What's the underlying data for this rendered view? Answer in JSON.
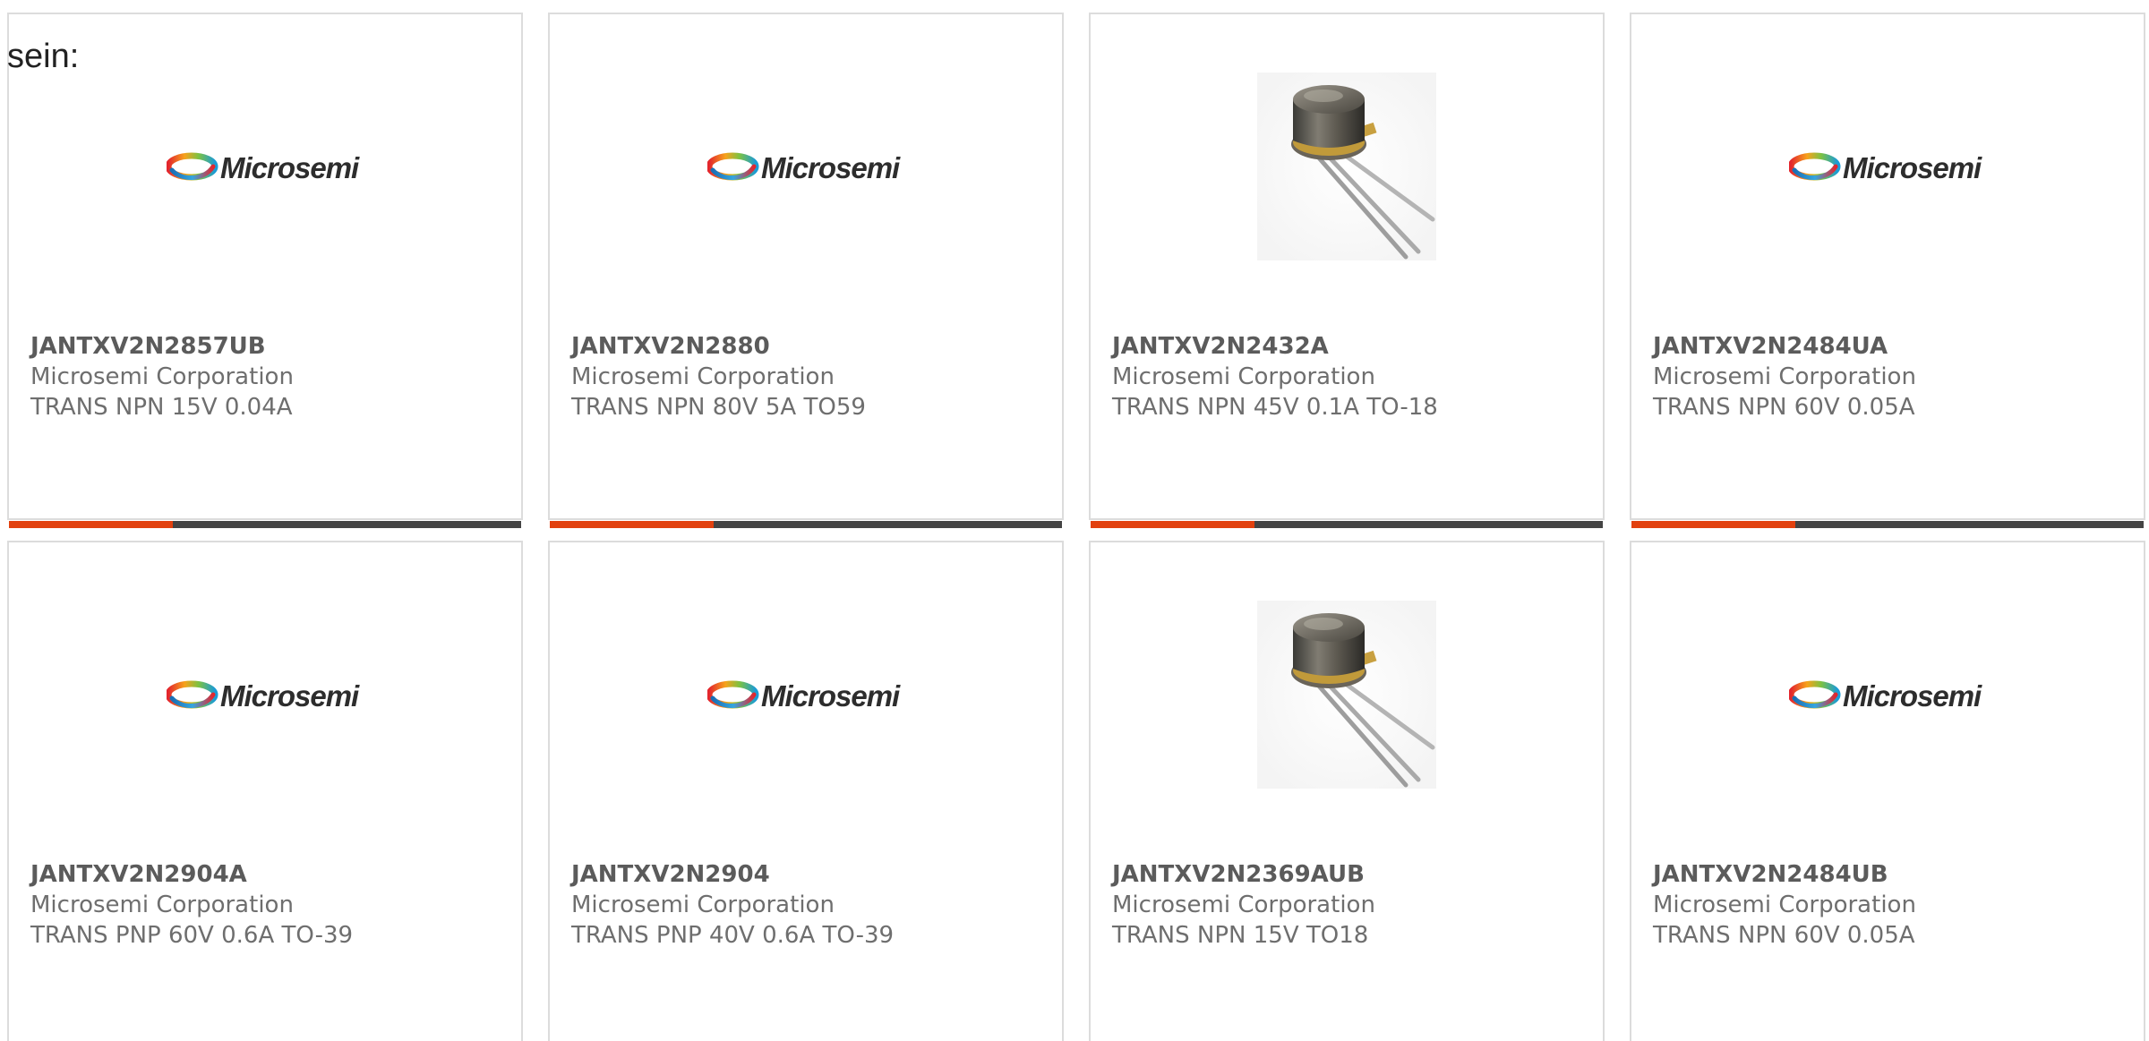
{
  "intro_text": "sein:",
  "colors": {
    "accent": "#e2410f",
    "track": "#444444",
    "card_border": "#dcdcdc",
    "part_text": "#5b5b5b",
    "meta_text": "#6e6e6e"
  },
  "products": [
    {
      "part": "JANTXV2N2857UB",
      "maker": "Microsemi Corporation",
      "desc": "TRANS NPN 15V 0.04A",
      "image": "microsemi-logo",
      "logo_text": "Microsemi",
      "progress": 0.32
    },
    {
      "part": "JANTXV2N2880",
      "maker": "Microsemi Corporation",
      "desc": "TRANS NPN 80V 5A TO59",
      "image": "microsemi-logo",
      "logo_text": "Microsemi",
      "progress": 0.32
    },
    {
      "part": "JANTXV2N2432A",
      "maker": "Microsemi Corporation",
      "desc": "TRANS NPN 45V 0.1A TO-18",
      "image": "transistor-to18-photo",
      "progress": 0.32
    },
    {
      "part": "JANTXV2N2484UA",
      "maker": "Microsemi Corporation",
      "desc": "TRANS NPN 60V 0.05A",
      "image": "microsemi-logo",
      "logo_text": "Microsemi",
      "progress": 0.32
    },
    {
      "part": "JANTXV2N2904A",
      "maker": "Microsemi Corporation",
      "desc": "TRANS PNP 60V 0.6A TO-39",
      "image": "microsemi-logo",
      "logo_text": "Microsemi"
    },
    {
      "part": "JANTXV2N2904",
      "maker": "Microsemi Corporation",
      "desc": "TRANS PNP 40V 0.6A TO-39",
      "image": "microsemi-logo",
      "logo_text": "Microsemi"
    },
    {
      "part": "JANTXV2N2369AUB",
      "maker": "Microsemi Corporation",
      "desc": "TRANS NPN 15V TO18",
      "image": "transistor-to18-photo"
    },
    {
      "part": "JANTXV2N2484UB",
      "maker": "Microsemi Corporation",
      "desc": "TRANS NPN 60V 0.05A",
      "image": "microsemi-logo",
      "logo_text": "Microsemi"
    }
  ]
}
